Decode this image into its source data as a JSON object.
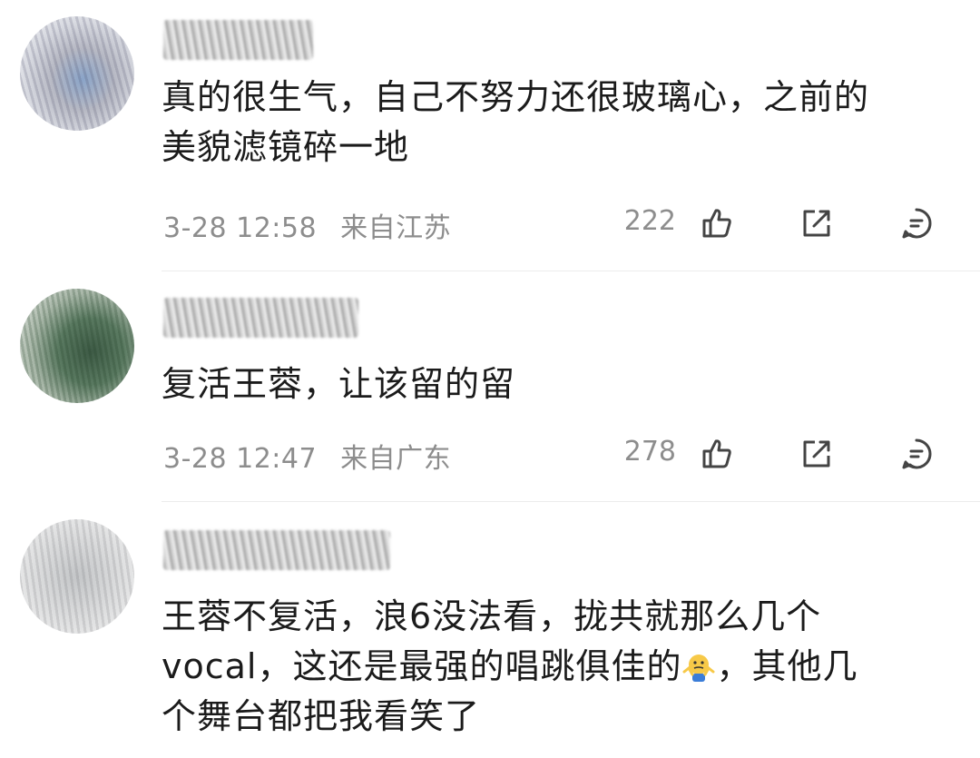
{
  "comments": [
    {
      "avatar_icon": "user-avatar-icon",
      "text": "真的很生气，自己不努力还很玻璃心，之前的\n美貌滤镜碎一地",
      "time": "3-28 12:58",
      "location": "来自江苏",
      "likes": "222"
    },
    {
      "avatar_icon": "user-avatar-icon",
      "text": "复活王蓉，让该留的留",
      "time": "3-28 12:47",
      "location": "来自广东",
      "likes": "278"
    },
    {
      "avatar_icon": "user-avatar-icon",
      "text_part1": "王蓉不复活，浪6没法看，拢共就那么几个\nvocal，这还是最强的唱跳俱佳的",
      "emoji": "shrug-emoji",
      "text_part2": "，其他几\n个舞台都把我看笑了"
    }
  ],
  "icons": {
    "like": "thumbs-up-icon",
    "share": "share-icon",
    "reply": "comment-icon"
  },
  "colors": {
    "text": "#1b1b1b",
    "meta": "#8d8d8d",
    "divider": "#ececec"
  }
}
